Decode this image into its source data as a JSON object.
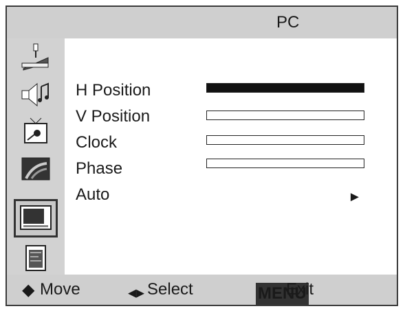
{
  "header": {
    "title": "PC"
  },
  "sidebar": {
    "icons": [
      "joystick-icon",
      "speaker-icon",
      "tv-icon",
      "picture-icon",
      "pc-monitor-icon",
      "document-icon"
    ],
    "active_index": 4
  },
  "menu": {
    "items": [
      {
        "label": "H Position",
        "type": "bar",
        "value": 1.0
      },
      {
        "label": "V Position",
        "type": "bar",
        "value": 0.0
      },
      {
        "label": "Clock",
        "type": "bar",
        "value": 0.0
      },
      {
        "label": "Phase",
        "type": "bar",
        "value": 0.0
      },
      {
        "label": "Auto",
        "type": "arrow",
        "arrow_glyph": "►"
      }
    ]
  },
  "footer": {
    "move_glyph": "◆",
    "move_label": "Move",
    "select_glyph": "◂▸",
    "select_label": "Select",
    "exit_key": "MENU",
    "exit_label": "Exit"
  },
  "colors": {
    "panel": "#cfcfcf",
    "text": "#1a1a1a",
    "fill": "#111111"
  }
}
